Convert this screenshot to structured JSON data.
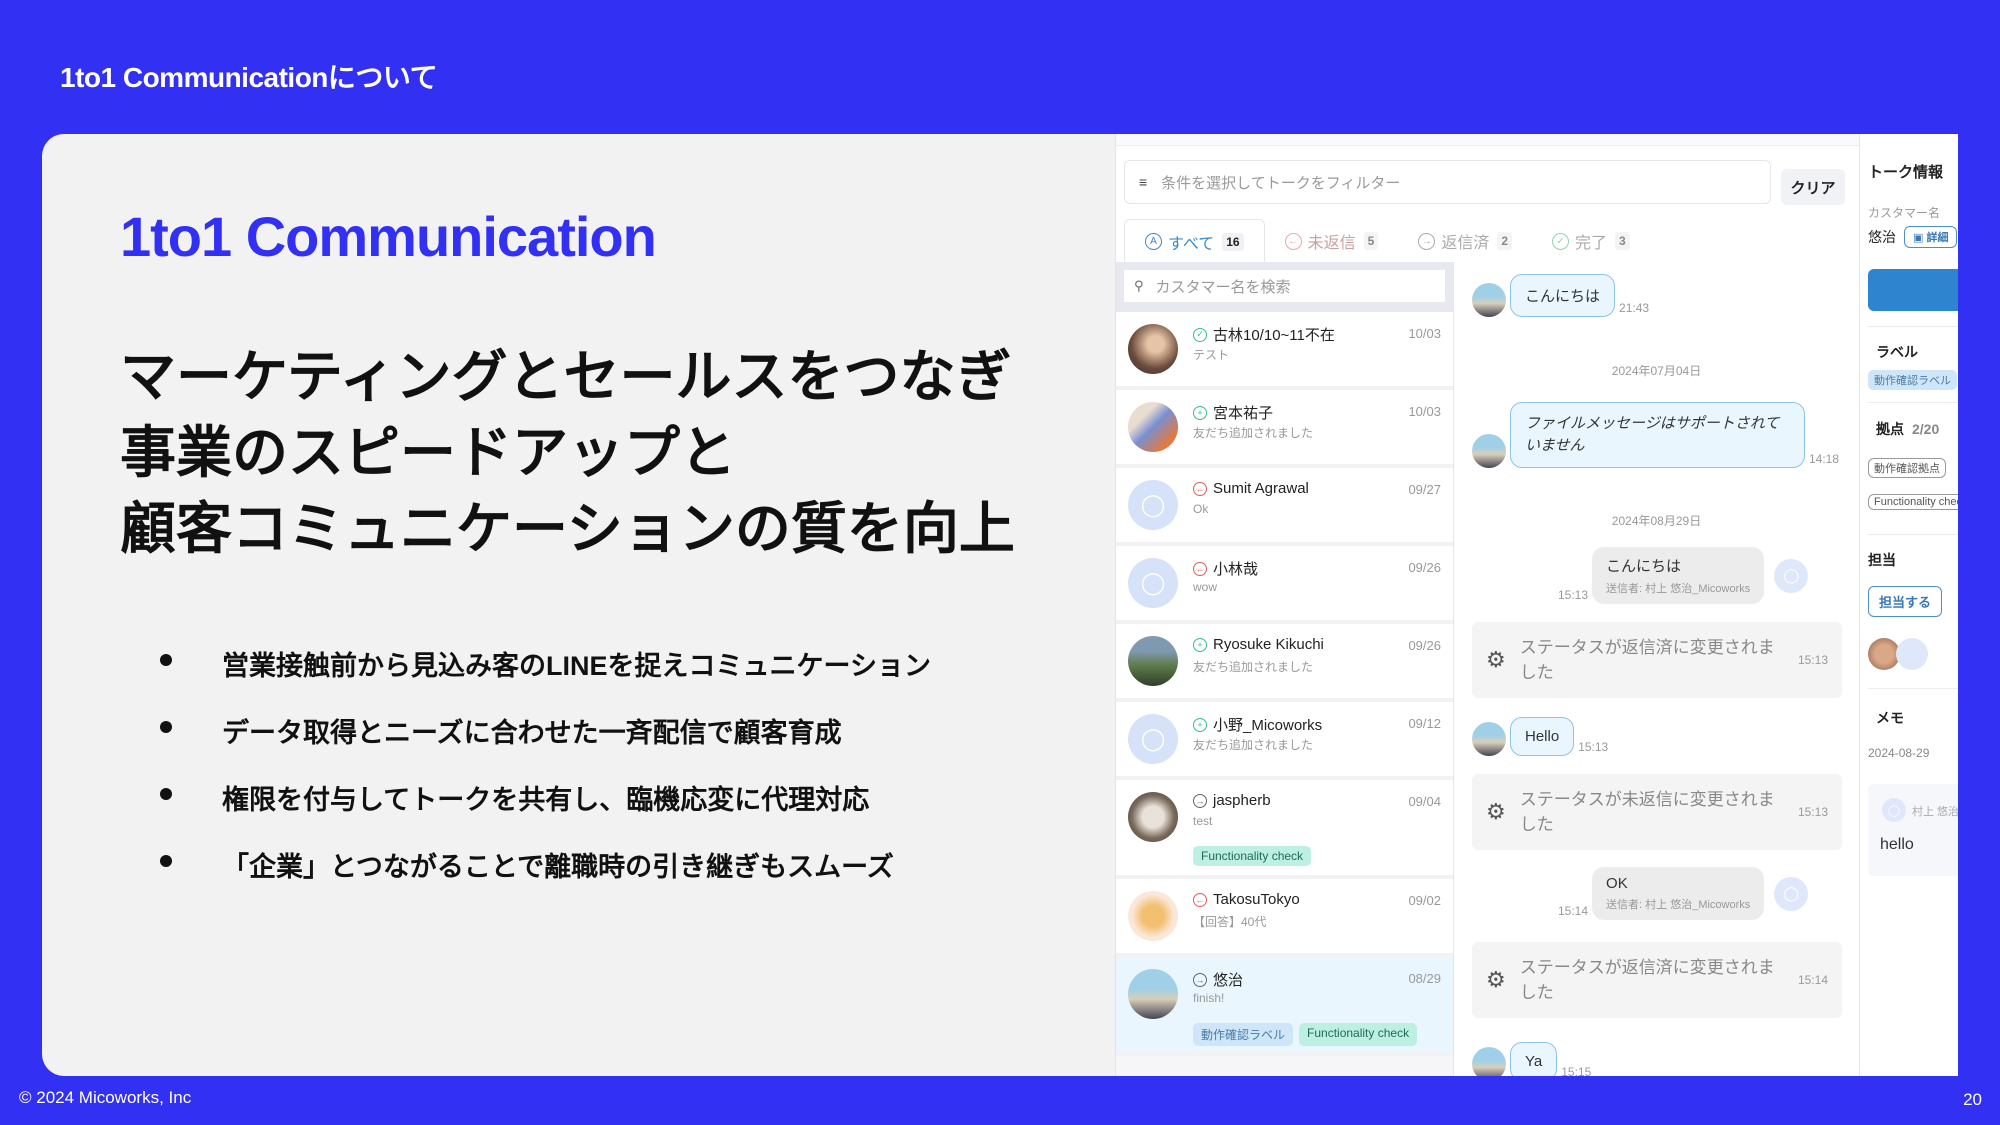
{
  "slide": {
    "header": "1to1 Communicationについて",
    "title": "1to1 Communication",
    "headline": [
      "マーケティングとセールスをつなぎ",
      "事業のスピードアップと",
      "顧客コミュニケーションの質を向上"
    ],
    "bullets": [
      "営業接触前から見込み客のLINEを捉えコミュニケーション",
      "データ取得とニーズに合わせた一斉配信で顧客育成",
      "権限を付与してトークを共有し、臨機応変に代理対応",
      "「企業」とつながることで離職時の引き継ぎもスムーズ"
    ],
    "footer_copyright": "© 2024 Micoworks, Inc",
    "page_number": "20"
  },
  "app": {
    "filter_placeholder": "条件を選択してトークをフィルター",
    "clear_label": "クリア",
    "tabs": [
      {
        "label": "すべて",
        "count": "16",
        "icon": "A"
      },
      {
        "label": "未返信",
        "count": "5",
        "icon": "←"
      },
      {
        "label": "返信済",
        "count": "2",
        "icon": "→"
      },
      {
        "label": "完了",
        "count": "3",
        "icon": "✓"
      }
    ],
    "search_placeholder": "カスタマー名を検索",
    "talks": [
      {
        "name": "古林10/10~11不在",
        "date": "10/03",
        "preview": "テスト",
        "status": "done"
      },
      {
        "name": "宮本祐子",
        "date": "10/03",
        "preview": "友だち追加されました",
        "status": "new"
      },
      {
        "name": "Sumit Agrawal",
        "date": "09/27",
        "preview": "Ok",
        "status": "unreplied"
      },
      {
        "name": "小林哉",
        "date": "09/26",
        "preview": "wow",
        "status": "unreplied"
      },
      {
        "name": "Ryosuke Kikuchi",
        "date": "09/26",
        "preview": "友だち追加されました",
        "status": "new"
      },
      {
        "name": "小野_Micoworks",
        "date": "09/12",
        "preview": "友だち追加されました",
        "status": "new"
      },
      {
        "name": "jaspherb",
        "date": "09/04",
        "preview": "test",
        "status": "replied",
        "tags": [
          "Functionality check"
        ]
      },
      {
        "name": "TakosuTokyo",
        "date": "09/02",
        "preview": "【回答】40代",
        "status": "unreplied"
      },
      {
        "name": "悠治",
        "date": "08/29",
        "preview": "finish!",
        "status": "replied",
        "tags": [
          "動作確認ラベル",
          "Functionality check"
        ]
      }
    ],
    "chat": {
      "msg1": {
        "text": "こんにちは",
        "time": "21:43"
      },
      "date1": "2024年07月04日",
      "msg2": {
        "text": "ファイルメッセージはサポートされていません",
        "time": "14:18"
      },
      "date2": "2024年08月29日",
      "msg3": {
        "text": "こんにちは",
        "sender": "送信者: 村上 悠治_Micoworks",
        "time": "15:13"
      },
      "sys1": {
        "text": "ステータスが返信済に変更されました",
        "time": "15:13"
      },
      "msg4": {
        "text": "Hello",
        "time": "15:13"
      },
      "sys2": {
        "text": "ステータスが未返信に変更されました",
        "time": "15:13"
      },
      "msg5": {
        "text": "OK",
        "sender": "送信者: 村上 悠治_Micoworks",
        "time": "15:14"
      },
      "sys3": {
        "text": "ステータスが返信済に変更されました",
        "time": "15:14"
      },
      "msg6": {
        "text": "Ya",
        "time": "15:15"
      }
    },
    "info": {
      "title": "トーク情報",
      "customer_label": "カスタマー名",
      "customer_name": "悠治",
      "detail_label": "詳細",
      "label_heading": "ラベル",
      "label_chip": "動作確認ラベル",
      "location_heading": "拠点",
      "location_count": "2/20",
      "location_chips": [
        "動作確認拠点",
        "Functionality check"
      ],
      "assignee_heading": "担当",
      "assign_button": "担当する",
      "memo_heading": "メモ",
      "memo_date": "2024-08-29",
      "memo_author": "村上 悠治",
      "memo_text": "hello"
    }
  },
  "colors": {
    "brand": "#3230f2",
    "accent_blue": "#2e84cf"
  }
}
